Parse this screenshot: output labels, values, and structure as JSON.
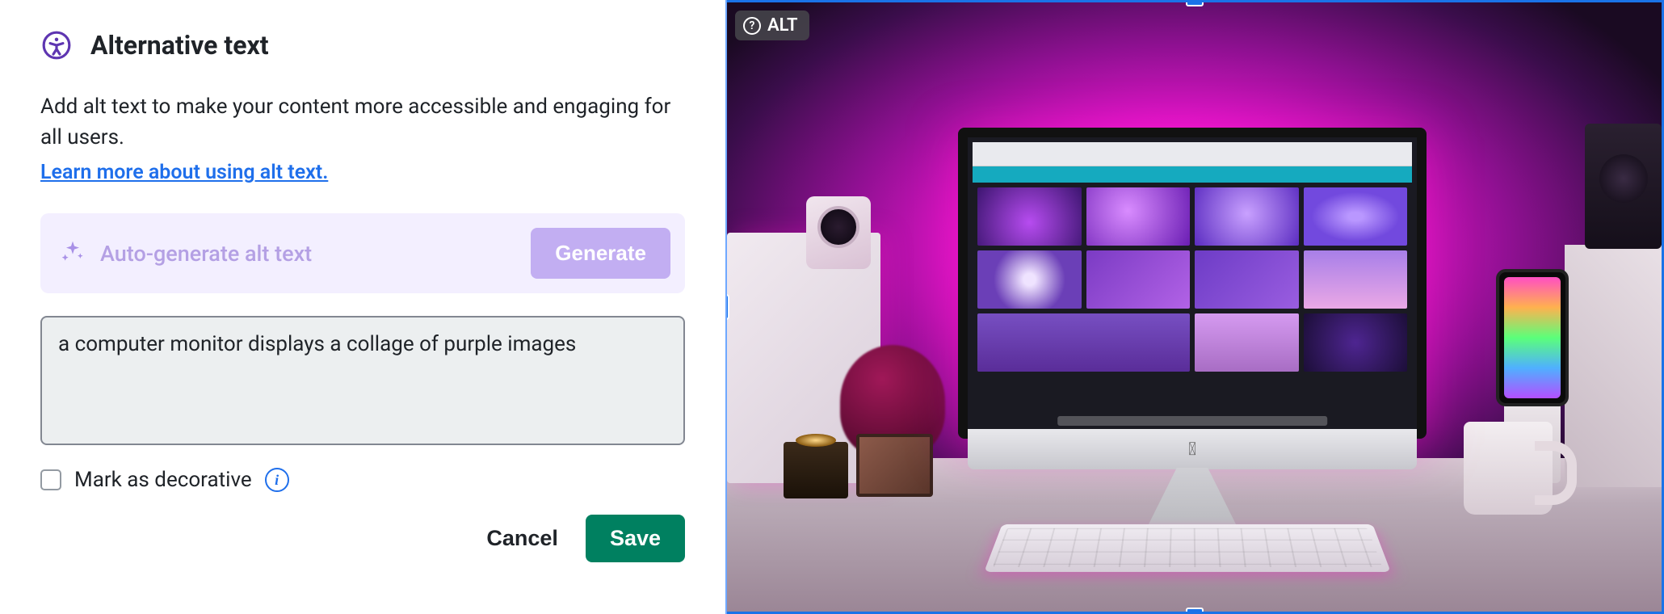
{
  "panel": {
    "title": "Alternative text",
    "description": "Add alt text to make your content more accessible and engaging for all users.",
    "learn_more": "Learn more about using alt text.",
    "generate": {
      "label": "Auto-generate alt text",
      "button": "Generate"
    },
    "textarea_value": "a computer monitor displays a collage of purple images",
    "decorative": {
      "label": "Mark as decorative",
      "checked": false
    },
    "actions": {
      "cancel": "Cancel",
      "save": "Save"
    }
  },
  "preview": {
    "alt_badge": "ALT"
  }
}
